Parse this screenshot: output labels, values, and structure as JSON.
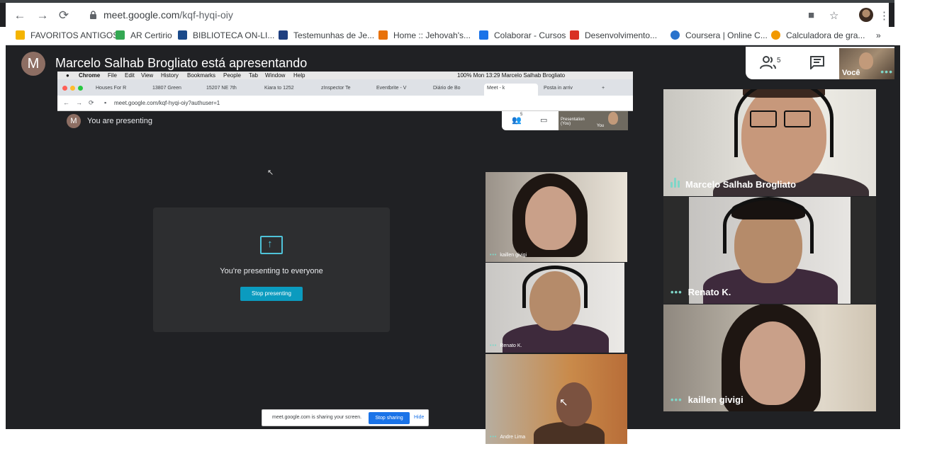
{
  "browser": {
    "url_host": "meet.google.com",
    "url_path": "/kqf-hyqi-oiy",
    "bookmarks": [
      {
        "label": "FAVORITOS ANTIGOS",
        "color": "#f4b400"
      },
      {
        "label": "AR Certirio",
        "color": "#34a853"
      },
      {
        "label": "BIBLIOTECA ON-LI...",
        "color": "#1a4a8a"
      },
      {
        "label": "Testemunhas de Je...",
        "color": "#1e3f80"
      },
      {
        "label": "Home :: Jehovah's...",
        "color": "#e8710a"
      },
      {
        "label": "Colaborar - Cursos",
        "color": "#1a73e8"
      },
      {
        "label": "Desenvolvimento...",
        "color": "#d93025"
      },
      {
        "label": "Coursera | Online C...",
        "color": "#2a73cc"
      },
      {
        "label": "Calculadora de gra...",
        "color": "#f29900"
      }
    ],
    "more_bookmarks": "»"
  },
  "meet": {
    "presenter_initial": "M",
    "presenting_title": "Marcelo Salhab Brogliato está apresentando",
    "people_count": "5",
    "self_label": "Você",
    "accent": "#7fd6c8"
  },
  "shared_screen": {
    "mac_menu": [
      "Chrome",
      "File",
      "Edit",
      "View",
      "History",
      "Bookmarks",
      "People",
      "Tab",
      "Window",
      "Help"
    ],
    "mac_status": "100%  Mon 13:29  Marcelo Salhab Brogliato",
    "tabs": [
      "Houses For R",
      "13807 Green",
      "15207 NE 7th",
      "Kiara to 1252",
      "zInspector Te",
      "Eventbrite - V",
      "Diário de Bo",
      "Meet - k",
      "Posta in arriv"
    ],
    "url": "meet.google.com/kqf-hyqi-oiy?authuser=1",
    "presenter_initial": "M",
    "you_are_presenting": "You are presenting",
    "presenting_to_everyone": "You're presenting to everyone",
    "stop_presenting": "Stop presenting",
    "people_count": "5",
    "self_tile_presentation": "Presentation (You)",
    "self_tile_you": "You",
    "sharing_notice": "meet.google.com is sharing your screen.",
    "stop_sharing": "Stop sharing",
    "hide": "Hide",
    "participants": [
      "kaillen givigi",
      "Renato K.",
      "Andre Lima"
    ]
  },
  "participants": [
    {
      "name": "Marcelo Salhab Brogliato",
      "speaking": true
    },
    {
      "name": "Renato K.",
      "speaking": false
    },
    {
      "name": "kaillen givigi",
      "speaking": false
    }
  ]
}
